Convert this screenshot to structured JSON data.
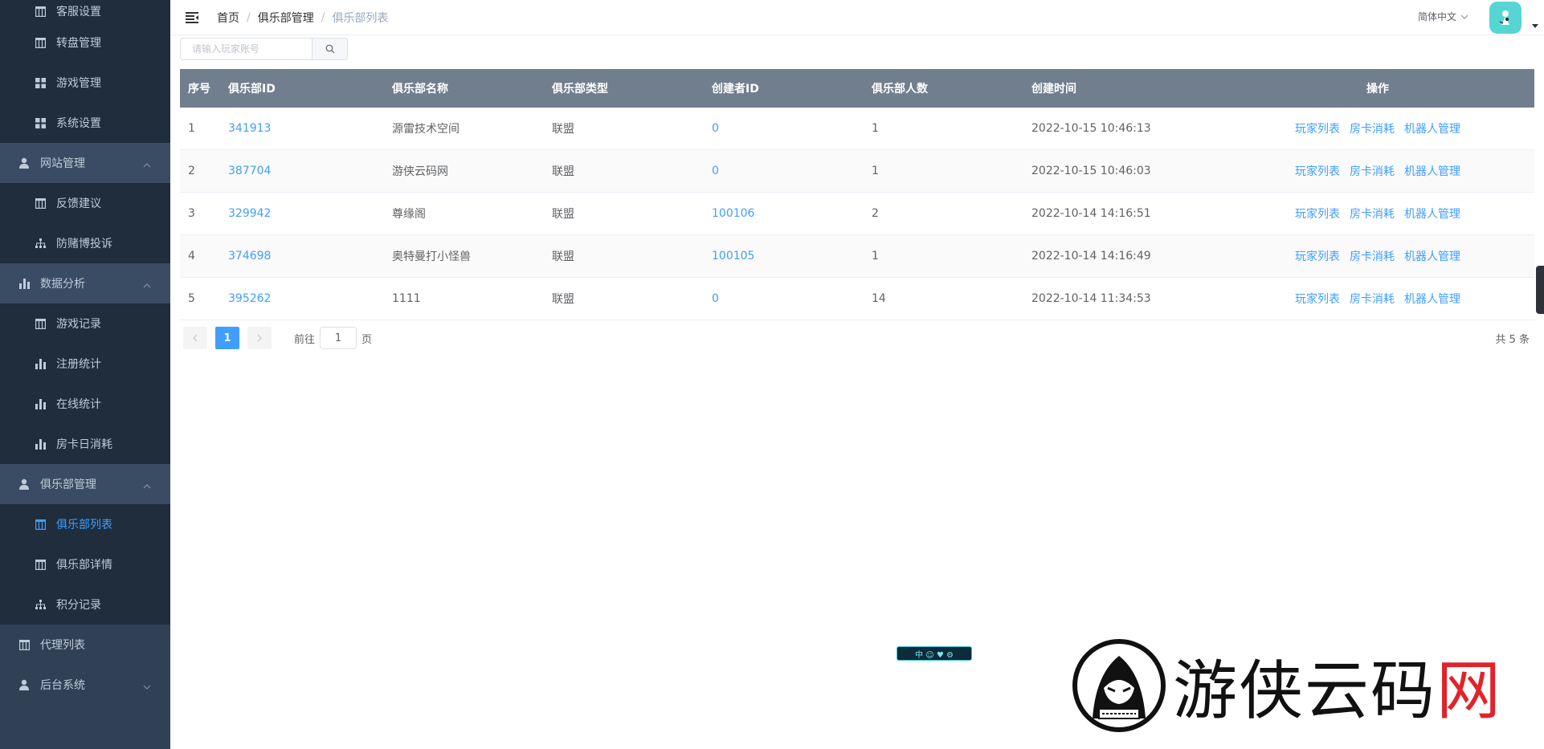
{
  "sidebar": {
    "items": [
      {
        "kind": "child",
        "label": "客服设置",
        "icon": "table-icon"
      },
      {
        "kind": "child",
        "label": "转盘管理",
        "icon": "table-icon"
      },
      {
        "kind": "child",
        "label": "游戏管理",
        "icon": "grid-icon"
      },
      {
        "kind": "child",
        "label": "系统设置",
        "icon": "grid-icon"
      },
      {
        "kind": "group",
        "label": "网站管理",
        "icon": "user-icon",
        "expanded": true
      },
      {
        "kind": "child",
        "label": "反馈建议",
        "icon": "table-icon"
      },
      {
        "kind": "child",
        "label": "防赌博投诉",
        "icon": "tree-icon"
      },
      {
        "kind": "group",
        "label": "数据分析",
        "icon": "chart-icon",
        "expanded": true
      },
      {
        "kind": "child",
        "label": "游戏记录",
        "icon": "table-icon"
      },
      {
        "kind": "child",
        "label": "注册统计",
        "icon": "chart-icon"
      },
      {
        "kind": "child",
        "label": "在线统计",
        "icon": "chart-icon"
      },
      {
        "kind": "child",
        "label": "房卡日消耗",
        "icon": "chart-icon"
      },
      {
        "kind": "group",
        "label": "俱乐部管理",
        "icon": "user-icon",
        "expanded": true
      },
      {
        "kind": "child",
        "label": "俱乐部列表",
        "icon": "table-icon",
        "active": true
      },
      {
        "kind": "child",
        "label": "俱乐部详情",
        "icon": "table-icon"
      },
      {
        "kind": "child",
        "label": "积分记录",
        "icon": "tree-icon"
      },
      {
        "kind": "group",
        "label": "代理列表",
        "icon": "table-icon"
      },
      {
        "kind": "group",
        "label": "后台系统",
        "icon": "user-icon",
        "expanded": false
      }
    ]
  },
  "header": {
    "breadcrumb": [
      "首页",
      "俱乐部管理",
      "俱乐部列表"
    ],
    "breadcrumb_sep": "/",
    "language": "简体中文"
  },
  "search": {
    "placeholder": "请输入玩家账号"
  },
  "table": {
    "columns": [
      "序号",
      "俱乐部ID",
      "俱乐部名称",
      "俱乐部类型",
      "创建者ID",
      "俱乐部人数",
      "创建时间",
      "操作"
    ],
    "rows": [
      {
        "no": "1",
        "club_id": "341913",
        "name": "源雷技术空间",
        "type": "联盟",
        "creator_id": "0",
        "members": "1",
        "created": "2022-10-15 10:46:13"
      },
      {
        "no": "2",
        "club_id": "387704",
        "name": "游侠云码网",
        "type": "联盟",
        "creator_id": "0",
        "members": "1",
        "created": "2022-10-15 10:46:03"
      },
      {
        "no": "3",
        "club_id": "329942",
        "name": "尊缘阁",
        "type": "联盟",
        "creator_id": "100106",
        "members": "2",
        "created": "2022-10-14 14:16:51"
      },
      {
        "no": "4",
        "club_id": "374698",
        "name": "奥特曼打小怪兽",
        "type": "联盟",
        "creator_id": "100105",
        "members": "1",
        "created": "2022-10-14 14:16:49"
      },
      {
        "no": "5",
        "club_id": "395262",
        "name": "1111",
        "type": "联盟",
        "creator_id": "0",
        "members": "14",
        "created": "2022-10-14 11:34:53"
      }
    ],
    "actions": [
      "玩家列表",
      "房卡消耗",
      "机器人管理"
    ]
  },
  "pagination": {
    "current_page": "1",
    "goto_label": "前往",
    "goto_value": "1",
    "page_unit": "页",
    "total_text": "共 5 条"
  },
  "badge": {
    "text": "中 ☺ ♥ ⚙"
  },
  "watermark": {
    "text_main": "游侠云码",
    "text_red": "网"
  },
  "colors": {
    "sidebar_bg": "#304156",
    "sidebar_child_bg": "#1f2d3d",
    "sidebar_text": "#bfcbd9",
    "accent": "#409eff",
    "table_header_bg": "#717e8e",
    "avatar_bg": "#56d5d5",
    "watermark_red": "#e0242b"
  }
}
